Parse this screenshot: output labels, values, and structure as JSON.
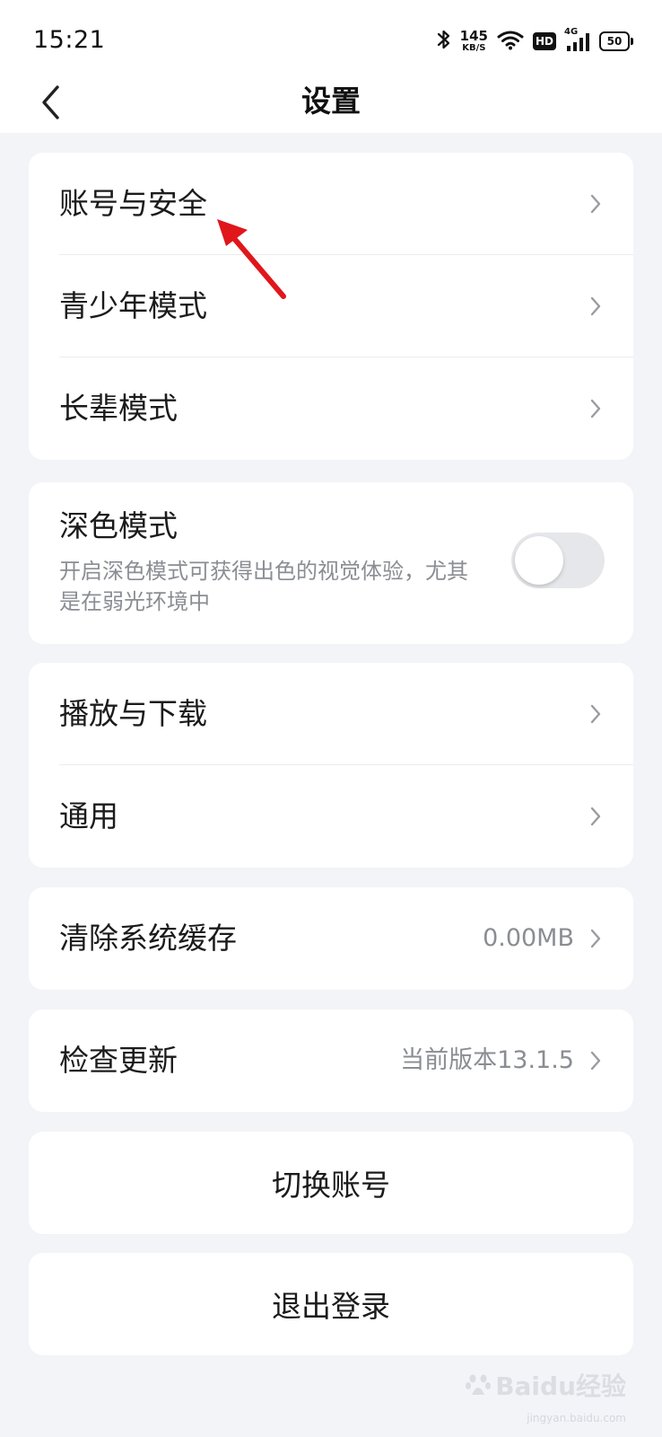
{
  "status_bar": {
    "time": "15:21",
    "net_speed_value": "145",
    "net_speed_unit": "KB/S",
    "hd_label": "HD",
    "network_label": "4G",
    "battery": "50"
  },
  "header": {
    "title": "设置"
  },
  "section1": {
    "items": [
      {
        "label": "账号与安全"
      },
      {
        "label": "青少年模式"
      },
      {
        "label": "长辈模式"
      }
    ]
  },
  "dark_mode": {
    "title": "深色模式",
    "description": "开启深色模式可获得出色的视觉体验，尤其是在弱光环境中",
    "enabled": false
  },
  "section3": {
    "items": [
      {
        "label": "播放与下载"
      },
      {
        "label": "通用"
      }
    ]
  },
  "cache": {
    "label": "清除系统缓存",
    "value": "0.00MB"
  },
  "update": {
    "label": "检查更新",
    "value": "当前版本13.1.5"
  },
  "actions": {
    "switch_account": "切换账号",
    "logout": "退出登录"
  },
  "watermark": {
    "text": "Baidu经验",
    "sub": "jingyan.baidu.com"
  },
  "colors": {
    "page_bg": "#f2f4f8",
    "card_bg": "#ffffff",
    "annotation_arrow": "#e0161b"
  }
}
